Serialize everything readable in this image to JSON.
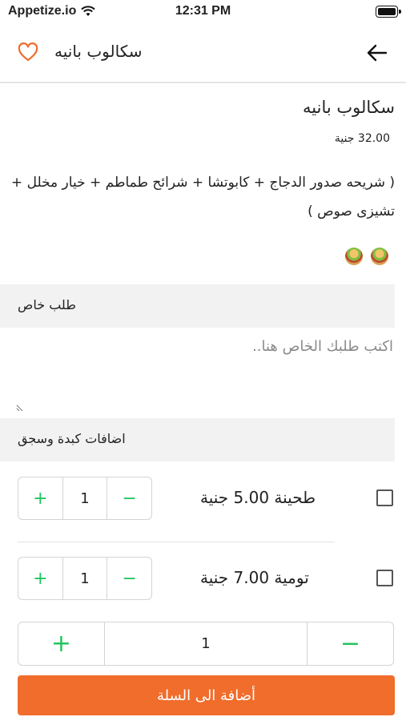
{
  "status_bar": {
    "carrier": "Appetize.io",
    "time": "12:31 PM"
  },
  "header": {
    "title": "سكالوب بانيه"
  },
  "product": {
    "name": "سكالوب بانيه",
    "price": "32.00 جنية",
    "description": "( شريحه صدور الدجاج + كابوتشا + شرائح طماطم + خيار مخلل + تشيزى صوص )"
  },
  "special_request": {
    "label": "طلب خاص",
    "placeholder": "اكتب طلبك الخاص هنا.."
  },
  "addons": {
    "label": "اضافات كبدة وسجق",
    "items": [
      {
        "name": "طحينة  5.00 جنية",
        "qty": "1",
        "plus": "+",
        "minus": "−"
      },
      {
        "name": "تومية  7.00 جنية",
        "qty": "1",
        "plus": "+",
        "minus": "−"
      }
    ]
  },
  "quantity": {
    "value": "1",
    "plus": "+",
    "minus": "−"
  },
  "cart_button": {
    "label": "أضافة الى السلة"
  },
  "colors": {
    "accent": "#f06d2c",
    "stepper": "#22c55e"
  }
}
